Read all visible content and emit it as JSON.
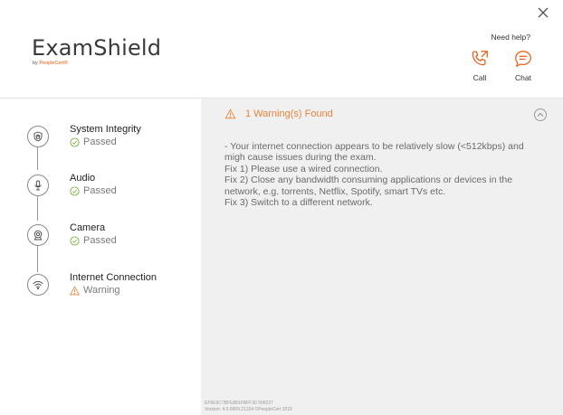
{
  "window": {
    "close_label": "×"
  },
  "header": {
    "logo_text": "ExamShield",
    "logo_by": "by ",
    "logo_brand": "PeopleCert",
    "logo_mark": "®",
    "need_help": "Need help?",
    "call_label": "Call",
    "chat_label": "Chat"
  },
  "accent_color": "#e8590c",
  "warning_color": "#e8843a",
  "success_color": "#7cb342",
  "steps": [
    {
      "title": "System Integrity",
      "status": "Passed",
      "icon": "shield-lock-icon",
      "status_icon": "check-circle-icon"
    },
    {
      "title": "Audio",
      "status": "Passed",
      "icon": "microphone-icon",
      "status_icon": "check-circle-icon"
    },
    {
      "title": "Camera",
      "status": "Passed",
      "icon": "webcam-icon",
      "status_icon": "check-circle-icon"
    },
    {
      "title": "Internet Connection",
      "status": "Warning",
      "icon": "wifi-icon",
      "status_icon": "warning-triangle-icon"
    }
  ],
  "panel": {
    "warning_title": "1 Warning(s) Found",
    "message_lines": [
      " - Your internet connection appears to be relatively slow (<512kbps) and migh cause issues during the exam.",
      "Fix 1) Please use a wired connection.",
      "Fix 2) Close any bandwidth consuming applications or devices in the network, e.g. torrents, Netflix, Spotify, smart TVs etc.",
      "Fix 3) Switch to a different network."
    ],
    "footer_line1": "EF6E9C7BFE881FBFF30 506227",
    "footer_line2": "Version: 4.0.6809.21334 ©PeopleCert 2018"
  }
}
